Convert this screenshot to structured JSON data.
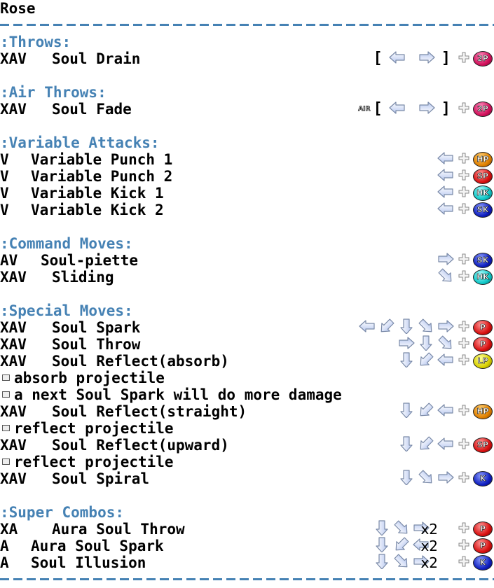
{
  "title": "Rose",
  "sections": {
    "throws": {
      "header": ":Throws:",
      "moves": [
        {
          "prefix": "XAV",
          "name": "Soul Drain",
          "input": [
            "[",
            "back/",
            "forward]",
            "+",
            "2P"
          ]
        }
      ]
    },
    "air_throws": {
      "header": ":Air Throws:",
      "moves": [
        {
          "prefix": "XAV",
          "name": "Soul Fade",
          "input": [
            "AIR",
            "[",
            "back/",
            "forward]",
            "+",
            "2P"
          ]
        }
      ]
    },
    "variable": {
      "header": ":Variable Attacks:",
      "moves": [
        {
          "prefix": "V",
          "name": "Variable Punch 1",
          "input": [
            "back",
            "+",
            "HP"
          ]
        },
        {
          "prefix": "V",
          "name": "Variable Punch 2",
          "input": [
            "back",
            "+",
            "SP"
          ]
        },
        {
          "prefix": "V",
          "name": "Variable Kick 1",
          "input": [
            "back",
            "+",
            "HK"
          ]
        },
        {
          "prefix": "V",
          "name": "Variable Kick 2",
          "input": [
            "back",
            "+",
            "SK"
          ]
        }
      ]
    },
    "command": {
      "header": ":Command Moves:",
      "moves": [
        {
          "prefix": "AV",
          "name": "Soul-piette",
          "input": [
            "forward",
            "+",
            "SK"
          ]
        },
        {
          "prefix": "XAV",
          "name": "Sliding",
          "input": [
            "down-forward",
            "+",
            "HK"
          ]
        }
      ]
    },
    "special": {
      "header": ":Special Moves:",
      "moves": [
        {
          "prefix": "XAV",
          "name": "Soul Spark",
          "input": [
            "back",
            "down-back",
            "down",
            "down-forward",
            "forward",
            "+",
            "P"
          ]
        },
        {
          "prefix": "XAV",
          "name": "Soul Throw",
          "input": [
            "forward",
            "down",
            "down-forward",
            "+",
            "P"
          ]
        },
        {
          "prefix": "XAV",
          "name": "Soul Reflect(absorb)",
          "input": [
            "down",
            "down-back",
            "back",
            "+",
            "LP"
          ]
        },
        {
          "note": "absorb projectile"
        },
        {
          "note": "a next Soul Spark will do more damage"
        },
        {
          "prefix": "XAV",
          "name": "Soul Reflect(straight)",
          "input": [
            "down",
            "down-back",
            "back",
            "+",
            "HP"
          ]
        },
        {
          "note": "reflect projectile"
        },
        {
          "prefix": "XAV",
          "name": "Soul Reflect(upward)",
          "input": [
            "down",
            "down-back",
            "back",
            "+",
            "SP"
          ]
        },
        {
          "note": "reflect projectile"
        },
        {
          "prefix": "XAV",
          "name": "Soul Spiral",
          "input": [
            "down",
            "down-forward",
            "forward",
            "+",
            "K"
          ]
        }
      ]
    },
    "super": {
      "header": ":Super Combos:",
      "moves": [
        {
          "prefix": "XA",
          "name": "Aura Soul Throw",
          "input": [
            "down",
            "down-forward",
            "forward",
            "x2",
            "+",
            "P"
          ]
        },
        {
          "prefix": "A",
          "name": "Aura Soul Spark",
          "input": [
            "down",
            "down-back",
            "back",
            "x2",
            "+",
            "P"
          ]
        },
        {
          "prefix": "A",
          "name": "Soul Illusion",
          "input": [
            "down",
            "down-forward",
            "forward",
            "x2",
            "+",
            "K"
          ]
        }
      ]
    }
  },
  "colors": {
    "header": "#4682b4",
    "separator": "#4682b4",
    "text": "#000000"
  }
}
